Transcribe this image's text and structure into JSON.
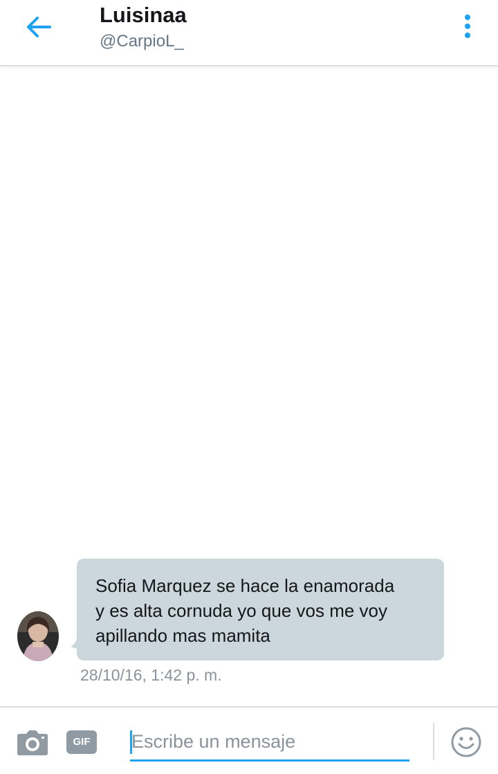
{
  "header": {
    "name": "Luisinaa",
    "handle": "@CarpioL_",
    "back_icon": "arrow-left-icon",
    "menu_icon": "more-vertical-icon",
    "accent_color": "#1da1f2"
  },
  "conversation": {
    "messages": [
      {
        "text": "Sofia Marquez se hace la enamorada\ny es alta cornuda yo que vos me voy\napillando mas mamita",
        "timestamp": "28/10/16, 1:42 p. m.",
        "bubble_color": "#ccd6dd"
      }
    ]
  },
  "composer": {
    "placeholder": "Escribe un mensaje",
    "value": "",
    "camera_icon": "camera-icon",
    "gif_label": "GIF",
    "emoji_icon": "smiley-icon"
  }
}
